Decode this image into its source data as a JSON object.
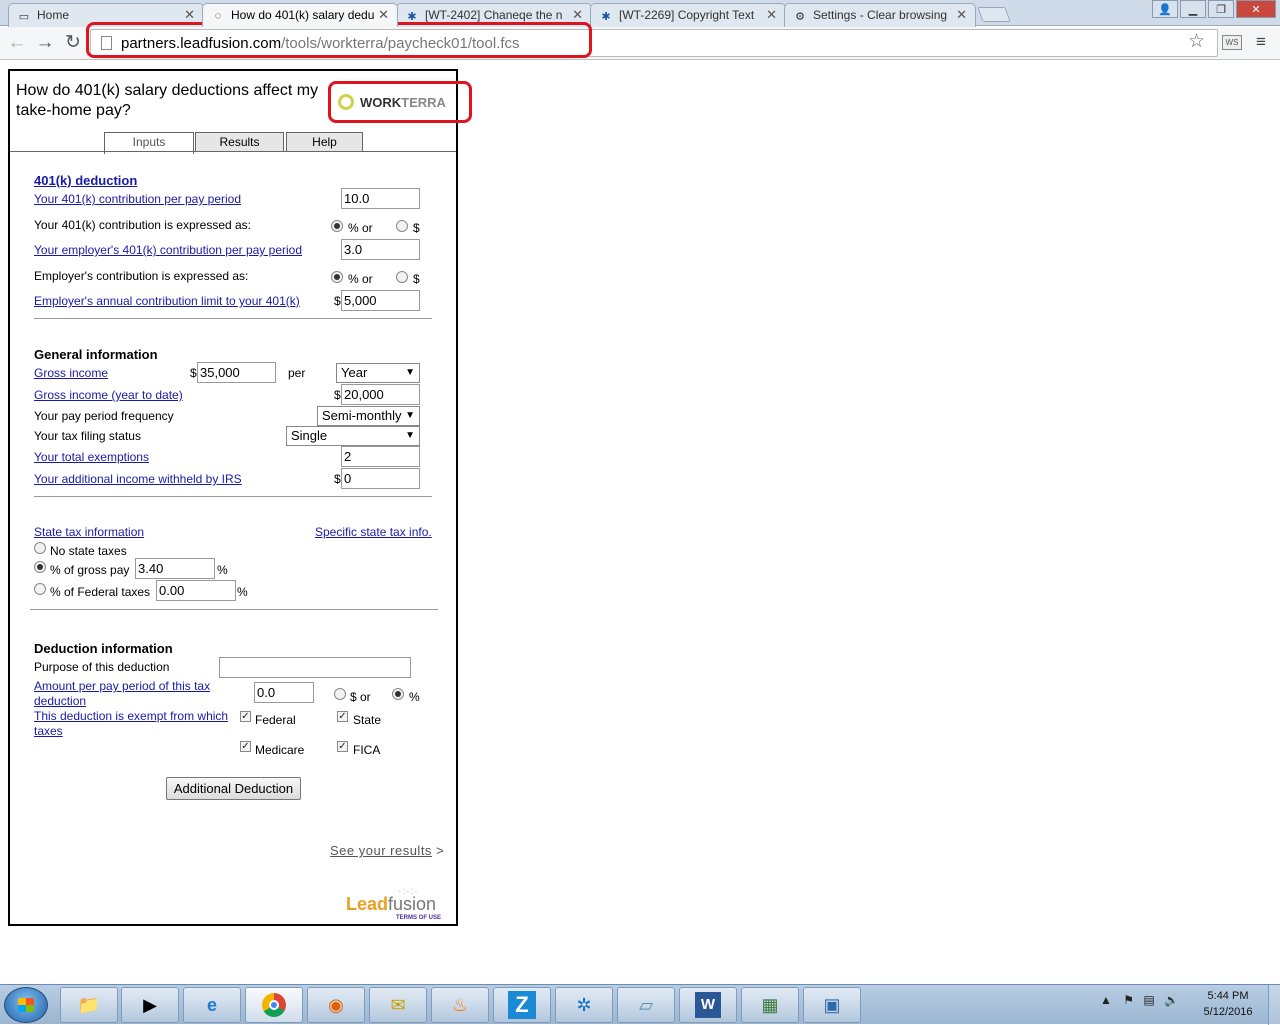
{
  "browser": {
    "tabs": [
      {
        "title": "Home",
        "icon": "page-icon"
      },
      {
        "title": "How do 401(k) salary dedu",
        "icon": "loading-icon"
      },
      {
        "title": "[WT-2402] Chaneqe the n",
        "icon": "jira-icon"
      },
      {
        "title": "[WT-2269] Copyright Text",
        "icon": "jira-icon"
      },
      {
        "title": "Settings - Clear browsing",
        "icon": "gear-icon"
      }
    ],
    "url_host": "partners.leadfusion.com",
    "url_path": "/tools/workterra/paycheck01/tool.fcs",
    "ext_label": "WS"
  },
  "widget": {
    "title": "How do 401(k) salary deductions affect my take-home pay?",
    "logo": {
      "part1": "WORK",
      "part2": "TERRA"
    },
    "tabs": [
      "Inputs",
      "Results",
      "Help"
    ],
    "deduction401k": {
      "heading": "401(k) deduction",
      "contribution_label": "Your 401(k) contribution per pay period",
      "contribution_value": "10.0",
      "expressed_label": "Your 401(k) contribution is expressed as:",
      "pct_or": "% or",
      "dollar": "$",
      "employer_label": "Your employer's 401(k) contribution per pay period",
      "employer_value": "3.0",
      "employer_expressed_label": "Employer's contribution is expressed as:",
      "limit_label": "Employer's annual contribution limit to your 401(k)",
      "limit_value": "5,000"
    },
    "general": {
      "heading": "General information",
      "gross_label": "Gross income",
      "gross_value": "35,000",
      "per": "per",
      "period_select": "Year",
      "ytd_label": "Gross income (year to date)",
      "ytd_value": "20,000",
      "frequency_label": "Your pay period frequency",
      "frequency_value": "Semi-monthly",
      "filing_label": "Your tax filing status",
      "filing_value": "Single",
      "exemptions_label": "Your total exemptions",
      "exemptions_value": "2",
      "additional_label": "Your additional income withheld by IRS",
      "additional_value": "0"
    },
    "state": {
      "heading": "State tax information",
      "specific_link": "Specific state tax info.",
      "none_label": "No state taxes",
      "gross_label": "% of gross pay",
      "gross_value": "3.40",
      "federal_label": "% of Federal taxes",
      "federal_value": "0.00",
      "pct": "%"
    },
    "deduction": {
      "heading": "Deduction information",
      "purpose_label": "Purpose of this deduction",
      "purpose_value": "",
      "amount_label_1": "Amount per pay period of this tax",
      "amount_label_2": "deduction",
      "amount_value": "0.0",
      "dollar_or": "$ or",
      "pct": "%",
      "exempt_label_1": "This deduction is exempt from which",
      "exempt_label_2": "taxes",
      "federal": "Federal",
      "state": "State",
      "medicare": "Medicare",
      "fica": "FICA",
      "add_button": "Additional Deduction"
    },
    "see_results": "See your results",
    "see_arrow": ">",
    "leadfusion": {
      "lead": "Lead",
      "fusion": "fusion",
      "terms": "TERMS OF USE"
    }
  },
  "taskbar": {
    "time": "5:44 PM",
    "date": "5/12/2016",
    "apps": [
      "explorer-icon",
      "media-icon",
      "ie-icon",
      "chrome-icon",
      "firefox-icon",
      "outlook-icon",
      "app-icon",
      "z-icon",
      "safari-icon",
      "notes-icon",
      "word-icon",
      "calc-icon",
      "image-icon"
    ]
  }
}
